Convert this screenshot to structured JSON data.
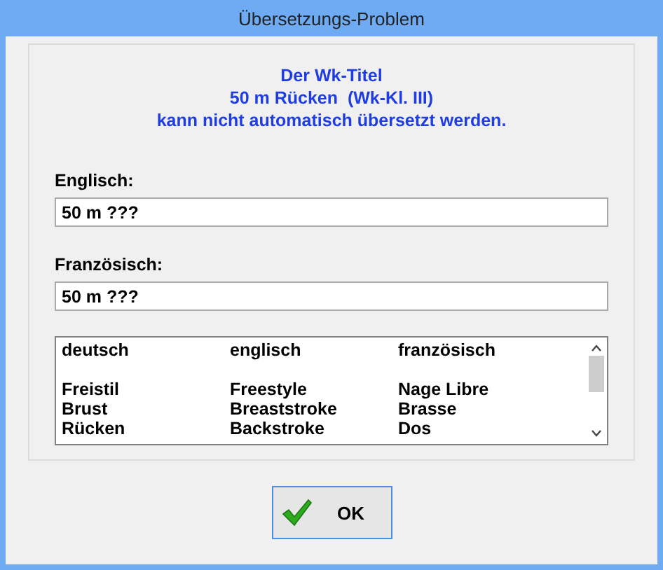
{
  "window": {
    "title": "Übersetzungs-Problem"
  },
  "message": [
    "Der Wk-Titel",
    "50 m Rücken  (Wk-Kl. III)",
    "kann nicht automatisch übersetzt werden."
  ],
  "fields": [
    {
      "label": "Englisch:",
      "value": "50 m ???"
    },
    {
      "label": "Französisch:",
      "value": "50 m ???"
    }
  ],
  "table": {
    "columns": [
      "deutsch",
      "englisch",
      "französisch"
    ],
    "rows": [
      [
        "Freistil",
        "Freestyle",
        "Nage Libre"
      ],
      [
        "Brust",
        "Breaststroke",
        "Brasse"
      ],
      [
        "Rücken",
        "Backstroke",
        "Dos"
      ]
    ]
  },
  "buttons": [
    {
      "label": "OK"
    }
  ]
}
